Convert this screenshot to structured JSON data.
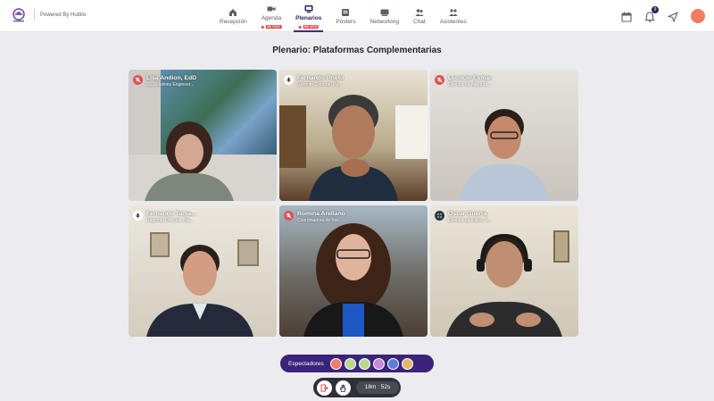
{
  "brand": {
    "powered_by": "Powered By Hubilo"
  },
  "nav": {
    "items": [
      {
        "id": "recepcion",
        "label": "Recepción"
      },
      {
        "id": "agenda",
        "label": "Agenda",
        "badge": "EN VIVO"
      },
      {
        "id": "plenarios",
        "label": "Plenarios",
        "badge": "EN VIVO",
        "active": true
      },
      {
        "id": "posters",
        "label": "Pósters"
      },
      {
        "id": "networking",
        "label": "Networking"
      },
      {
        "id": "chat",
        "label": "Chat"
      },
      {
        "id": "asistentes",
        "label": "Asistentes"
      }
    ]
  },
  "header_actions": {
    "notification_count": "9"
  },
  "stage": {
    "title": "Plenario: Plataformas Complementarias"
  },
  "participants": [
    {
      "name": "Lisa Andion, EdD",
      "role": "Sr. Solutions Engineer...",
      "mic": "muted"
    },
    {
      "name": "Fernando Prieto",
      "role": "Gerente General, Po...",
      "mic": "on"
    },
    {
      "name": "Leoncio Esmar",
      "role": "Director de Asegura...",
      "mic": "muted"
    },
    {
      "name": "Fernando Tama...",
      "role": "Regional Director, Bla...",
      "mic": "on"
    },
    {
      "name": "Romina Arellano",
      "role": "Coordinadora de Inte...",
      "mic": "muted"
    },
    {
      "name": "Oscar Guerra",
      "role": "Director ejecutivo, F...",
      "mic": "grid"
    }
  ],
  "spectators": {
    "label": "Espectadores"
  },
  "controls": {
    "timer": "18m : 52s"
  },
  "colors": {
    "accent": "#3a237a",
    "live": "#e53e3e",
    "muted": "#e05252"
  }
}
